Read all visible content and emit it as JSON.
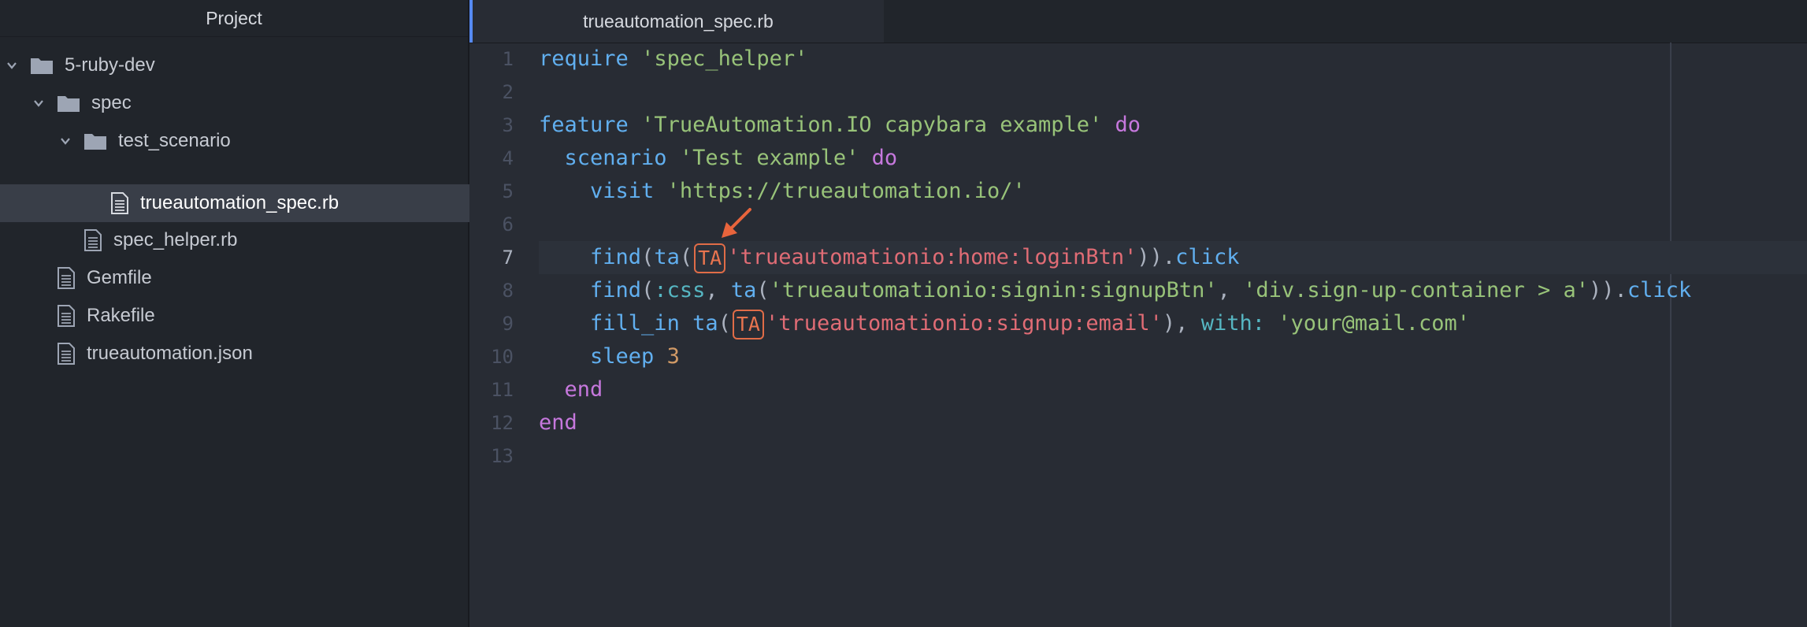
{
  "sidebar": {
    "title": "Project",
    "tree": [
      {
        "label": "5-ruby-dev",
        "type": "folder",
        "expanded": true
      },
      {
        "label": "spec",
        "type": "folder",
        "expanded": true
      },
      {
        "label": "test_scenario",
        "type": "folder",
        "expanded": true
      },
      {
        "label": "trueautomation_spec.rb",
        "type": "file",
        "selected": true
      },
      {
        "label": "spec_helper.rb",
        "type": "file"
      },
      {
        "label": "Gemfile",
        "type": "file"
      },
      {
        "label": "Rakefile",
        "type": "file"
      },
      {
        "label": "trueautomation.json",
        "type": "file"
      }
    ]
  },
  "editor": {
    "tab_title": "trueautomation_spec.rb",
    "line_numbers": [
      "1",
      "2",
      "3",
      "4",
      "5",
      "6",
      "7",
      "8",
      "9",
      "10",
      "11",
      "12",
      "13"
    ],
    "active_line": "7",
    "badge": "TA",
    "lines": {
      "l1": {
        "a": "require",
        "b": "'spec_helper'"
      },
      "l3": {
        "a": "feature",
        "b": "'TrueAutomation.IO capybara example'",
        "c": "do"
      },
      "l4": {
        "a": "scenario",
        "b": "'Test example'",
        "c": "do"
      },
      "l5": {
        "a": "visit",
        "b": "'https://trueautomation.io/'"
      },
      "l7": {
        "a": "find",
        "b": "ta",
        "c": "'trueautomationio:home:loginBtn'",
        "d": "click"
      },
      "l8": {
        "a": "find",
        "b": ":css",
        "c": "ta",
        "d": "'trueautomationio:signin:signupBtn'",
        "e": "'div.sign-up-container > a'",
        "f": "click"
      },
      "l9": {
        "a": "fill_in",
        "b": "ta",
        "c": "'trueautomationio:signup:email'",
        "d": "with:",
        "e": "'your@mail.com'"
      },
      "l10": {
        "a": "sleep",
        "b": "3"
      },
      "l11": {
        "a": "end"
      },
      "l12": {
        "a": "end"
      }
    }
  },
  "colors": {
    "background": "#282c34",
    "sidebar": "#21252b",
    "keyword": "#c678dd",
    "function": "#61afef",
    "string": "#98c379",
    "ta_string": "#e06c75",
    "symbol": "#56b6c2",
    "number": "#d19a66",
    "badge_border": "#e06c47",
    "tab_accent": "#568af2"
  },
  "icons": [
    "chevron-down-icon",
    "folder-icon",
    "file-icon",
    "arrow-annotation-icon"
  ]
}
